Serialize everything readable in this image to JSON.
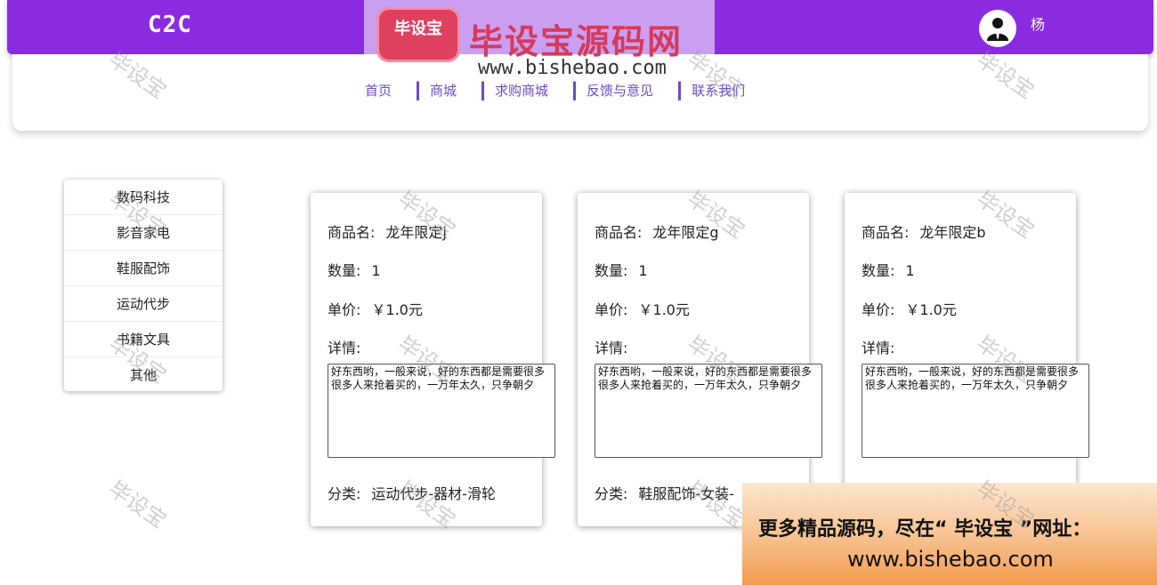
{
  "header": {
    "brand": "C2C",
    "user_name": "杨"
  },
  "nav": {
    "items": [
      "首页",
      "商城",
      "求购商城",
      "反馈与意见",
      "联系我们"
    ]
  },
  "sidebar": {
    "categories": [
      "数码科技",
      "影音家电",
      "鞋服配饰",
      "运动代步",
      "书籍文具",
      "其他"
    ]
  },
  "labels": {
    "name": "商品名:",
    "quantity": "数量:",
    "price": "单价:",
    "detail": "详情:",
    "category": "分类:"
  },
  "products": [
    {
      "name": "龙年限定j",
      "quantity": "1",
      "price": "￥1.0元",
      "detail": "好东西哟，一般来说，好的东西都是需要很多很多人来抢着买的，一万年太久，只争朝夕",
      "category": "运动代步-器材-滑轮"
    },
    {
      "name": "龙年限定g",
      "quantity": "1",
      "price": "￥1.0元",
      "detail": "好东西哟，一般来说，好的东西都是需要很多很多人来抢着买的，一万年太久，只争朝夕",
      "category": "鞋服配饰-女装-"
    },
    {
      "name": "龙年限定b",
      "quantity": "1",
      "price": "￥1.0元",
      "detail": "好东西哟，一般来说，好的东西都是需要很多很多人来抢着买的，一万年太久，只争朝夕",
      "category": ""
    }
  ],
  "watermark": {
    "text": "毕设宝",
    "logo_badge": "毕设宝",
    "logo_title": "毕设宝源码网",
    "logo_url": "www.bishebao.com",
    "promo_line1": "更多精品源码，尽在“ 毕设宝 ”网址：",
    "promo_line2": "www.bishebao.com"
  },
  "colors": {
    "header_bg": "#8a2be2",
    "nav_text": "#6a4cc9"
  }
}
